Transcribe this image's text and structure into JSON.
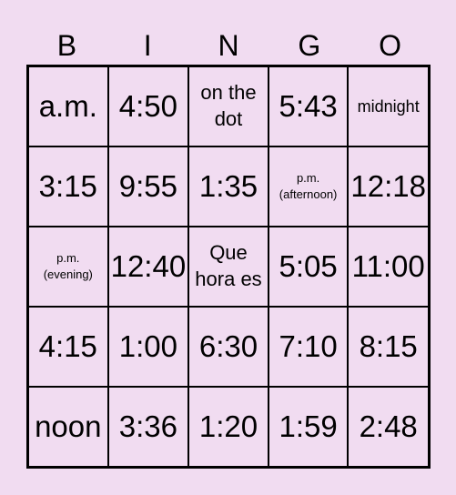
{
  "header": [
    "B",
    "I",
    "N",
    "G",
    "O"
  ],
  "cells": [
    "a.m.",
    "4:50",
    "on the dot",
    "5:43",
    "midnight",
    "3:15",
    "9:55",
    "1:35",
    "p.m. (afternoon)",
    "12:18",
    "p.m. (evening)",
    "12:40",
    "Que hora es",
    "5:05",
    "11:00",
    "4:15",
    "1:00",
    "6:30",
    "7:10",
    "8:15",
    "noon",
    "3:36",
    "1:20",
    "1:59",
    "2:48"
  ],
  "colors": {
    "background": "#f1dcf1",
    "lines": "#000000"
  }
}
